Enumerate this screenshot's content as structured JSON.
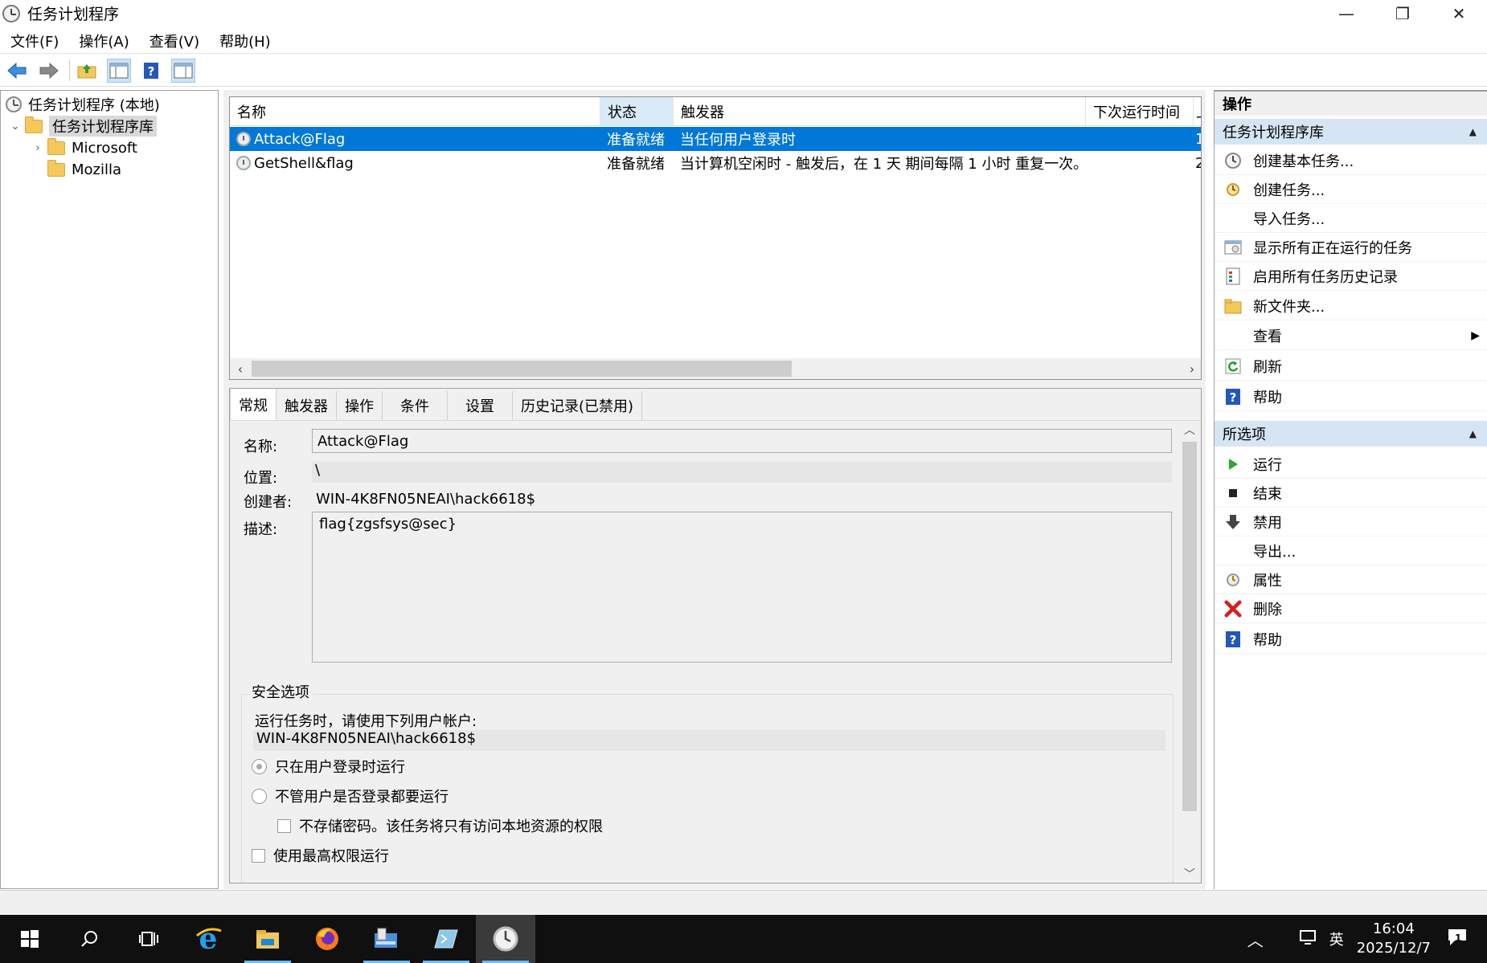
{
  "window": {
    "title": "任务计划程序",
    "minimize": "—",
    "restore": "❐",
    "close": "✕"
  },
  "menu": [
    "文件(F)",
    "操作(A)",
    "查看(V)",
    "帮助(H)"
  ],
  "tree": {
    "root": "任务计划程序 (本地)",
    "library": "任务计划程序库",
    "children": [
      "Microsoft",
      "Mozilla"
    ]
  },
  "list": {
    "columns": [
      "名称",
      "状态",
      "触发器",
      "下次运行时间",
      "上"
    ],
    "rows": [
      {
        "name": "Attack@Flag",
        "status": "准备就绪",
        "trigger": "当任何用户登录时",
        "next": "1"
      },
      {
        "name": "GetShell&flag",
        "status": "准备就绪",
        "trigger": "当计算机空闲时 - 触发后，在 1 天 期间每隔 1 小时 重复一次。",
        "next": "2"
      }
    ]
  },
  "detail": {
    "tabs": [
      "常规",
      "触发器",
      "操作",
      "条件",
      "设置",
      "历史记录(已禁用)"
    ],
    "name_label": "名称:",
    "name_value": "Attack@Flag",
    "location_label": "位置:",
    "location_value": "\\",
    "author_label": "创建者:",
    "author_value": "WIN-4K8FN05NEAI\\hack6618$",
    "desc_label": "描述:",
    "desc_value": "flag{zgsfsys@sec}",
    "security": {
      "title": "安全选项",
      "run_as_label": "运行任务时，请使用下列用户帐户:",
      "run_as_value": "WIN-4K8FN05NEAI\\hack6618$",
      "opt_logged_on": "只在用户登录时运行",
      "opt_whether": "不管用户是否登录都要运行",
      "opt_no_password": "不存储密码。该任务将只有访问本地资源的权限",
      "opt_highest": "使用最高权限运行"
    }
  },
  "actions": {
    "header": "操作",
    "section1": "任务计划程序库",
    "items1": [
      "创建基本任务...",
      "创建任务...",
      "导入任务...",
      "显示所有正在运行的任务",
      "启用所有任务历史记录",
      "新文件夹...",
      "查看",
      "刷新",
      "帮助"
    ],
    "section2": "所选项",
    "items2": [
      "运行",
      "结束",
      "禁用",
      "导出...",
      "属性",
      "删除",
      "帮助"
    ]
  },
  "taskbar": {
    "time": "16:04",
    "date": "2025/12/7",
    "ime": "英",
    "notification_count": "1"
  },
  "colors": {
    "selection": "#0078d7",
    "section_header": "#d6e5f4",
    "taskbar": "#101010"
  }
}
